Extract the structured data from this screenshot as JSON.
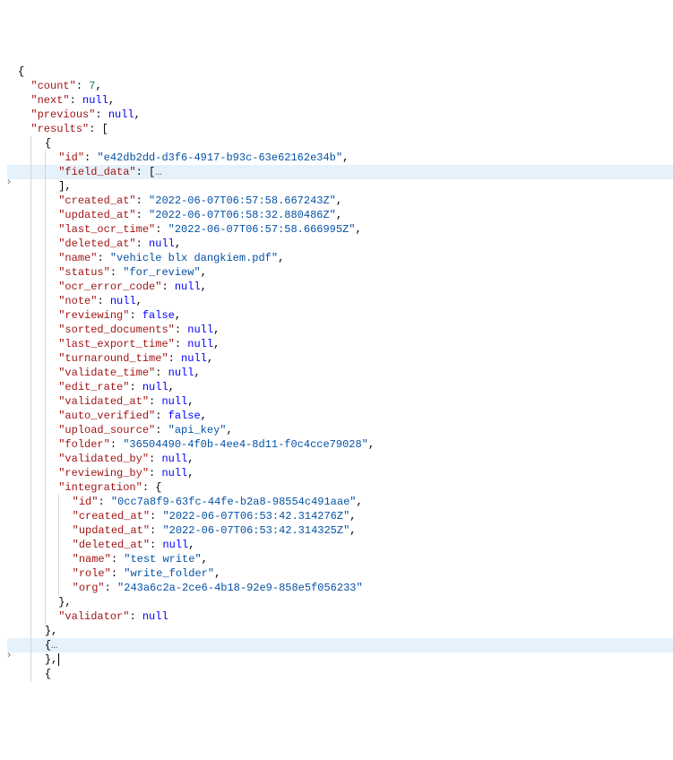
{
  "count_key": "count",
  "count_val": "7",
  "next_key": "next",
  "next_val": "null",
  "previous_key": "previous",
  "previous_val": "null",
  "results_key": "results",
  "r0": {
    "id_key": "id",
    "id_val": "\"e42db2dd-d3f6-4917-b93c-63e62162e34b\"",
    "field_data_key": "field_data",
    "created_at_key": "created_at",
    "created_at_val": "\"2022-06-07T06:57:58.667243Z\"",
    "updated_at_key": "updated_at",
    "updated_at_val": "\"2022-06-07T06:58:32.880486Z\"",
    "last_ocr_time_key": "last_ocr_time",
    "last_ocr_time_val": "\"2022-06-07T06:57:58.666995Z\"",
    "deleted_at_key": "deleted_at",
    "deleted_at_val": "null",
    "name_key": "name",
    "name_val": "\"vehicle blx dangkiem.pdf\"",
    "status_key": "status",
    "status_val": "\"for_review\"",
    "ocr_error_code_key": "ocr_error_code",
    "ocr_error_code_val": "null",
    "note_key": "note",
    "note_val": "null",
    "reviewing_key": "reviewing",
    "reviewing_val": "false",
    "sorted_documents_key": "sorted_documents",
    "sorted_documents_val": "null",
    "last_export_time_key": "last_export_time",
    "last_export_time_val": "null",
    "turnaround_time_key": "turnaround_time",
    "turnaround_time_val": "null",
    "validate_time_key": "validate_time",
    "validate_time_val": "null",
    "edit_rate_key": "edit_rate",
    "edit_rate_val": "null",
    "validated_at_key": "validated_at",
    "validated_at_val": "null",
    "auto_verified_key": "auto_verified",
    "auto_verified_val": "false",
    "upload_source_key": "upload_source",
    "upload_source_val": "\"api_key\"",
    "folder_key": "folder",
    "folder_val": "\"36504490-4f0b-4ee4-8d11-f0c4cce79028\"",
    "validated_by_key": "validated_by",
    "validated_by_val": "null",
    "reviewing_by_key": "reviewing_by",
    "reviewing_by_val": "null",
    "integration_key": "integration",
    "validator_key": "validator",
    "validator_val": "null"
  },
  "intg": {
    "id_key": "id",
    "id_val": "\"0cc7a8f9-63fc-44fe-b2a8-98554c491aae\"",
    "created_at_key": "created_at",
    "created_at_val": "\"2022-06-07T06:53:42.314276Z\"",
    "updated_at_key": "updated_at",
    "updated_at_val": "\"2022-06-07T06:53:42.314325Z\"",
    "deleted_at_key": "deleted_at",
    "deleted_at_val": "null",
    "name_key": "name",
    "name_val": "\"test write\"",
    "role_key": "role",
    "role_val": "\"write_folder\"",
    "org_key": "org",
    "org_val": "\"243a6c2a-2ce6-4b18-92e9-858e5f056233\""
  },
  "arrow_glyph": "›"
}
